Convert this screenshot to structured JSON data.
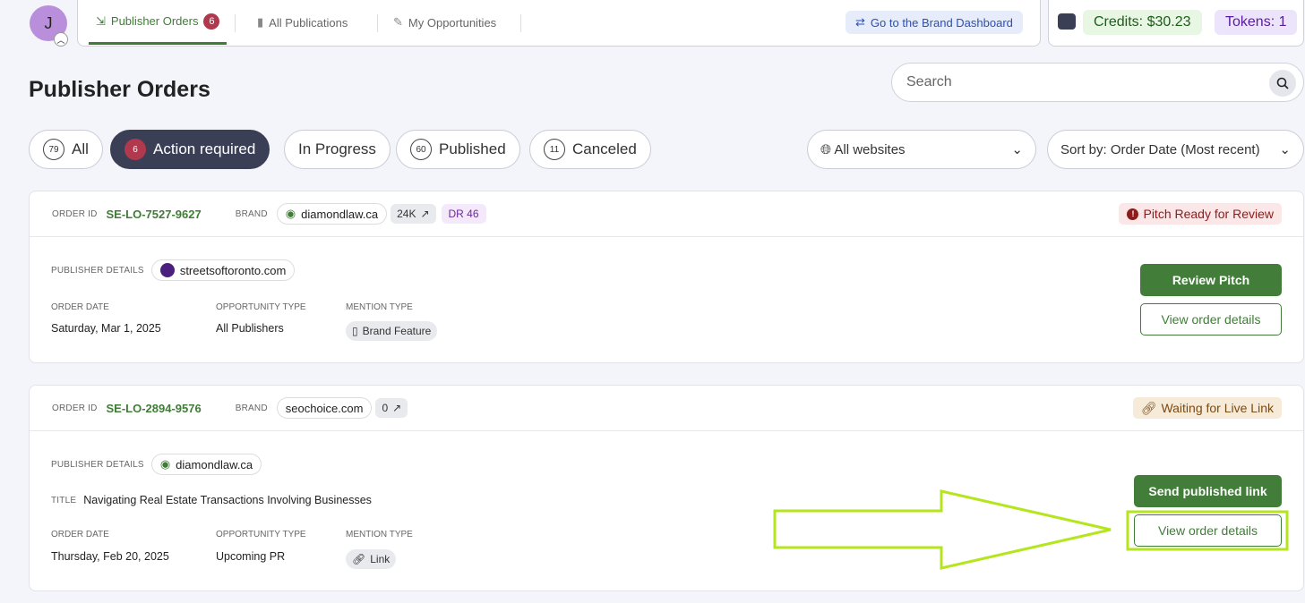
{
  "user": {
    "initial": "J"
  },
  "nav": {
    "tabs": [
      {
        "label": "Publisher Orders",
        "badge": "6"
      },
      {
        "label": "All Publications"
      },
      {
        "label": "My Opportunities"
      }
    ],
    "brand_dashboard": "Go to the Brand Dashboard"
  },
  "wallet": {
    "credits": "Credits: $30.23",
    "tokens": "Tokens: 1"
  },
  "page": {
    "title": "Publisher Orders",
    "search_placeholder": "Search"
  },
  "filters": [
    {
      "count": "79",
      "label": "All"
    },
    {
      "count": "6",
      "label": "Action required"
    },
    {
      "label": "In Progress"
    },
    {
      "count": "60",
      "label": "Published"
    },
    {
      "count": "11",
      "label": "Canceled"
    }
  ],
  "websites_select": "All websites",
  "sort_select": "Sort by: Order Date (Most recent)",
  "labels": {
    "order_id": "ORDER ID",
    "brand": "BRAND",
    "publisher_details": "PUBLISHER DETAILS",
    "order_date": "ORDER DATE",
    "opportunity_type": "OPPORTUNITY TYPE",
    "mention_type": "MENTION TYPE",
    "title": "TITLE"
  },
  "orders": [
    {
      "id": "SE-LO-7527-9627",
      "brand": "diamondlaw.ca",
      "traffic": "24K",
      "dr": "DR 46",
      "status": "Pitch Ready for Review",
      "publisher": "streetsoftoronto.com",
      "order_date": "Saturday, Mar 1, 2025",
      "opportunity_type": "All Publishers",
      "mention_type": "Brand Feature",
      "primary_action": "Review Pitch",
      "secondary_action": "View order details"
    },
    {
      "id": "SE-LO-2894-9576",
      "brand": "seochoice.com",
      "traffic": "0",
      "status": "Waiting for Live Link",
      "publisher": "diamondlaw.ca",
      "title": "Navigating Real Estate Transactions Involving Businesses",
      "order_date": "Thursday, Feb 20, 2025",
      "opportunity_type": "Upcoming PR",
      "mention_type": "Link",
      "primary_action": "Send published link",
      "secondary_action": "View order details"
    }
  ],
  "colors": {
    "accent": "#437d3a",
    "annotation": "#b5e61d"
  }
}
